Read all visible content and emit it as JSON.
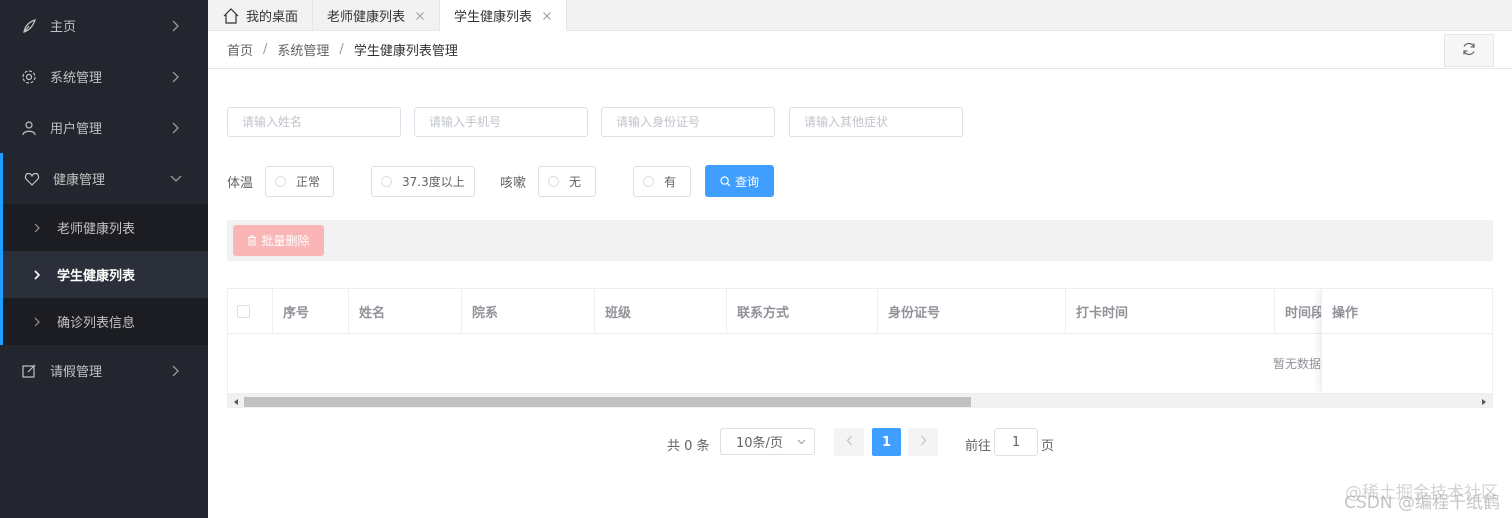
{
  "sidebar": {
    "items": [
      {
        "label": "主页"
      },
      {
        "label": "系统管理"
      },
      {
        "label": "用户管理"
      },
      {
        "label": "健康管理"
      },
      {
        "label": "请假管理"
      }
    ],
    "sub_items": [
      {
        "label": "老师健康列表"
      },
      {
        "label": "学生健康列表"
      },
      {
        "label": "确诊列表信息"
      }
    ]
  },
  "tabs": [
    {
      "label": "我的桌面"
    },
    {
      "label": "老师健康列表"
    },
    {
      "label": "学生健康列表"
    }
  ],
  "breadcrumb": {
    "items": [
      "首页",
      "系统管理",
      "学生健康列表管理"
    ],
    "separator": "/"
  },
  "search": {
    "name_placeholder": "请输入姓名",
    "phone_placeholder": "请输入手机号",
    "id_placeholder": "请输入身份证号",
    "symptom_placeholder": "请输入其他症状",
    "temperature_label": "体温",
    "temp_normal": "正常",
    "temp_high": "37.3度以上",
    "cough_label": "咳嗽",
    "cough_no": "无",
    "cough_yes": "有",
    "query_label": "查询"
  },
  "toolbar": {
    "batch_delete_label": "批量删除"
  },
  "table": {
    "columns": [
      "序号",
      "姓名",
      "院系",
      "班级",
      "联系方式",
      "身份证号",
      "打卡时间",
      "时间段",
      "操作"
    ],
    "empty_text": "暂无数据"
  },
  "pagination": {
    "total_text": "共 0 条",
    "page_size": "10条/页",
    "current_page": "1",
    "goto_label": "前往",
    "goto_value": "1",
    "page_suffix": "页"
  },
  "watermark": {
    "line1": "@稀土掘金技术社区",
    "line2": "CSDN @编程千纸鹤"
  },
  "colors": {
    "sidebar_bg": "#23262e",
    "accent": "#409eff",
    "danger_light": "#fab6b6",
    "active_border": "#1e9fff"
  }
}
